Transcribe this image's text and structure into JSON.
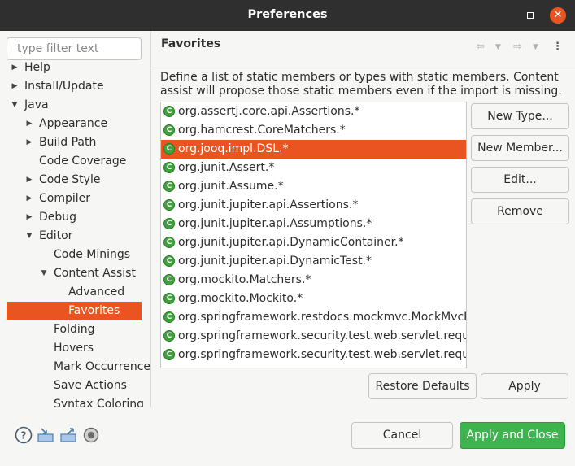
{
  "window": {
    "title": "Preferences"
  },
  "filter": {
    "placeholder": "type filter text"
  },
  "tree": [
    {
      "label": "Help",
      "arrow": "right",
      "indent": 0
    },
    {
      "label": "Install/Update",
      "arrow": "right",
      "indent": 0
    },
    {
      "label": "Java",
      "arrow": "down",
      "indent": 0
    },
    {
      "label": "Appearance",
      "arrow": "right",
      "indent": 1
    },
    {
      "label": "Build Path",
      "arrow": "right",
      "indent": 1
    },
    {
      "label": "Code Coverage",
      "arrow": "",
      "indent": 1
    },
    {
      "label": "Code Style",
      "arrow": "right",
      "indent": 1
    },
    {
      "label": "Compiler",
      "arrow": "right",
      "indent": 1
    },
    {
      "label": "Debug",
      "arrow": "right",
      "indent": 1
    },
    {
      "label": "Editor",
      "arrow": "down",
      "indent": 1
    },
    {
      "label": "Code Minings",
      "arrow": "",
      "indent": 2
    },
    {
      "label": "Content Assist",
      "arrow": "down",
      "indent": 2
    },
    {
      "label": "Advanced",
      "arrow": "",
      "indent": 3
    },
    {
      "label": "Favorites",
      "arrow": "",
      "indent": 3,
      "selected": true
    },
    {
      "label": "Folding",
      "arrow": "",
      "indent": 2
    },
    {
      "label": "Hovers",
      "arrow": "",
      "indent": 2
    },
    {
      "label": "Mark Occurrences",
      "arrow": "",
      "indent": 2
    },
    {
      "label": "Save Actions",
      "arrow": "",
      "indent": 2
    },
    {
      "label": "Syntax Coloring",
      "arrow": "",
      "indent": 2
    }
  ],
  "page": {
    "title": "Favorites",
    "description": "Define a list of static members or types with static members. Content assist will propose those static members even if the import is missing."
  },
  "favorites": [
    "org.assertj.core.api.Assertions.*",
    "org.hamcrest.CoreMatchers.*",
    "org.jooq.impl.DSL.*",
    "org.junit.Assert.*",
    "org.junit.Assume.*",
    "org.junit.jupiter.api.Assertions.*",
    "org.junit.jupiter.api.Assumptions.*",
    "org.junit.jupiter.api.DynamicContainer.*",
    "org.junit.jupiter.api.DynamicTest.*",
    "org.mockito.Matchers.*",
    "org.mockito.Mockito.*",
    "org.springframework.restdocs.mockmvc.MockMvcRequestDocumentation.*",
    "org.springframework.security.test.web.servlet.request.SecurityMockMvcRequestPostProcessors.*",
    "org.springframework.security.test.web.servlet.request.SecurityMockMvcRequestBuilders.*"
  ],
  "selected_favorite": "org.jooq.impl.DSL.*",
  "buttons": {
    "new_type": "New Type...",
    "new_member": "New Member...",
    "edit": "Edit...",
    "remove": "Remove",
    "restore_defaults": "Restore Defaults",
    "apply": "Apply",
    "cancel": "Cancel",
    "apply_and_close": "Apply and Close"
  },
  "colors": {
    "accent": "#e95420",
    "titlebar": "#2f2f2f",
    "primary_button": "#3eb34f",
    "favorite_icon": "#3fa33b"
  }
}
